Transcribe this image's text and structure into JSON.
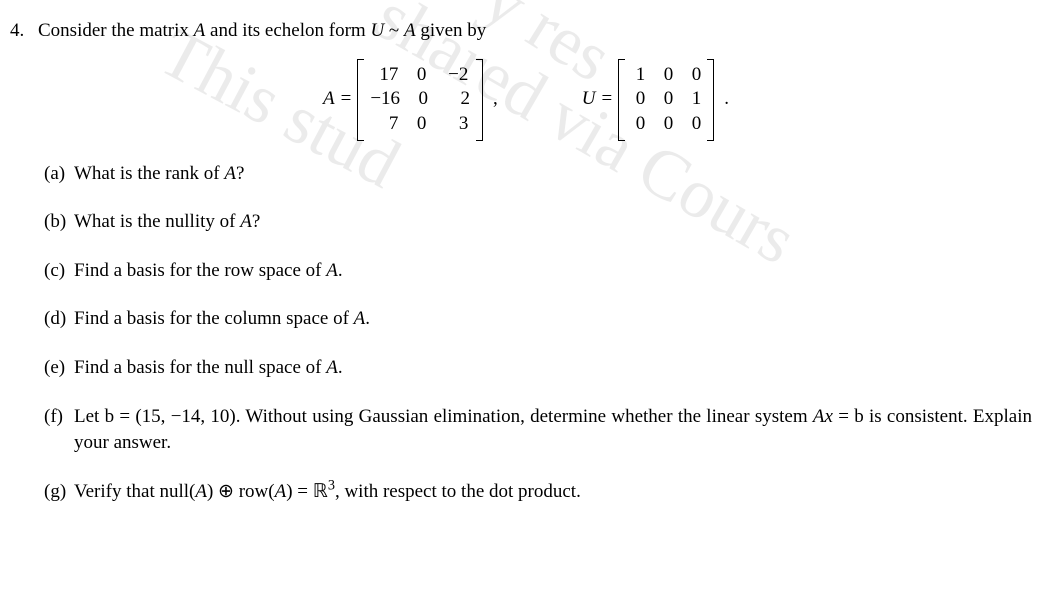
{
  "problem": {
    "number": "4.",
    "intro_pre": "Consider the matrix ",
    "intro_A": "A",
    "intro_mid": " and its echelon form ",
    "intro_U": "U",
    "intro_sim": " ~ ",
    "intro_A2": "A",
    "intro_post": " given by"
  },
  "matrices": {
    "A_label": "A",
    "eq": " = ",
    "A": [
      [
        "17",
        "0",
        "−2"
      ],
      [
        "−16",
        "0",
        "2"
      ],
      [
        "7",
        "0",
        "3"
      ]
    ],
    "sep": ",",
    "U_label": "U",
    "U": [
      [
        "1",
        "0",
        "0"
      ],
      [
        "0",
        "0",
        "1"
      ],
      [
        "0",
        "0",
        "0"
      ]
    ],
    "end": "."
  },
  "subs": {
    "a": {
      "label": "(a)",
      "pre": "What is the rank of ",
      "var": "A",
      "post": "?"
    },
    "b": {
      "label": "(b)",
      "pre": "What is the nullity of ",
      "var": "A",
      "post": "?"
    },
    "c": {
      "label": "(c)",
      "pre": "Find a basis for the row space of ",
      "var": "A",
      "post": "."
    },
    "d": {
      "label": "(d)",
      "pre": "Find a basis for the column space of ",
      "var": "A",
      "post": "."
    },
    "e": {
      "label": "(e)",
      "pre": "Find a basis for the null space of ",
      "var": "A",
      "post": "."
    },
    "f": {
      "label": "(f)",
      "t1": "Let ",
      "b": "b",
      "t2": " = (15, −14, 10).  Without using Gaussian elimination, determine whether the linear system ",
      "Ax": "Ax",
      "t3": " = ",
      "b2": "b",
      "t4": " is consistent. Explain your answer."
    },
    "g": {
      "label": "(g)",
      "t1": "Verify that null(",
      "A1": "A",
      "t2": ") ⊕ row(",
      "A2": "A",
      "t3": ") = ",
      "R": "ℝ",
      "exp": "3",
      "t4": ", with respect to the dot product."
    }
  },
  "watermarks": {
    "w1": "This stud",
    "w2": "shared via Cours",
    "w3": "y res"
  }
}
